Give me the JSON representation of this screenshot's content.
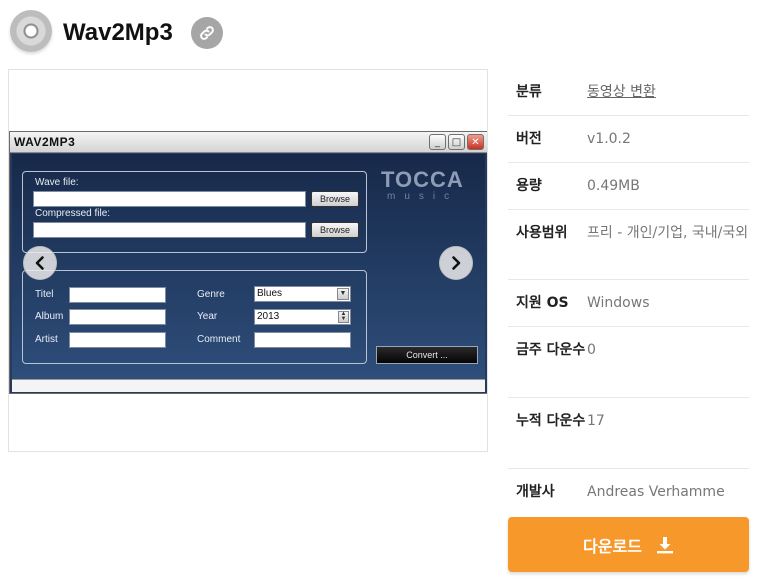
{
  "header": {
    "title": "Wav2Mp3",
    "logo_icon": "cd-disc-icon",
    "link_icon": "link-icon"
  },
  "gallery": {
    "prev_icon": "chevron-left-icon",
    "next_icon": "chevron-right-icon",
    "screenshot": {
      "window_title": "WAV2MP3",
      "wave_file_label": "Wave file:",
      "compressed_file_label": "Compressed file:",
      "browse_label": "Browse",
      "titel_label": "Titel",
      "album_label": "Album",
      "artist_label": "Artist",
      "genre_label": "Genre",
      "genre_value": "Blues",
      "year_label": "Year",
      "year_value": "2013",
      "comment_label": "Comment",
      "convert_label": "Convert ...",
      "brand": "TOCCA",
      "brand_sub": "music"
    }
  },
  "info": {
    "rows": [
      {
        "key": "분류",
        "value": "동영상 변환",
        "link": true
      },
      {
        "key": "버전",
        "value": "v1.0.2"
      },
      {
        "key": "용량",
        "value": "0.49MB"
      },
      {
        "key": "사용범위",
        "value": "프리 - 개인/기업, 국내/국외"
      },
      {
        "key": "지원 OS",
        "value": "Windows"
      },
      {
        "key": "금주 다운수",
        "value": "0"
      },
      {
        "key": "누적 다운수",
        "value": "17"
      },
      {
        "key": "개발사",
        "value": "Andreas Verhamme"
      }
    ]
  },
  "download": {
    "label": "다운로드",
    "icon": "download-icon",
    "color": "#f7982a"
  }
}
